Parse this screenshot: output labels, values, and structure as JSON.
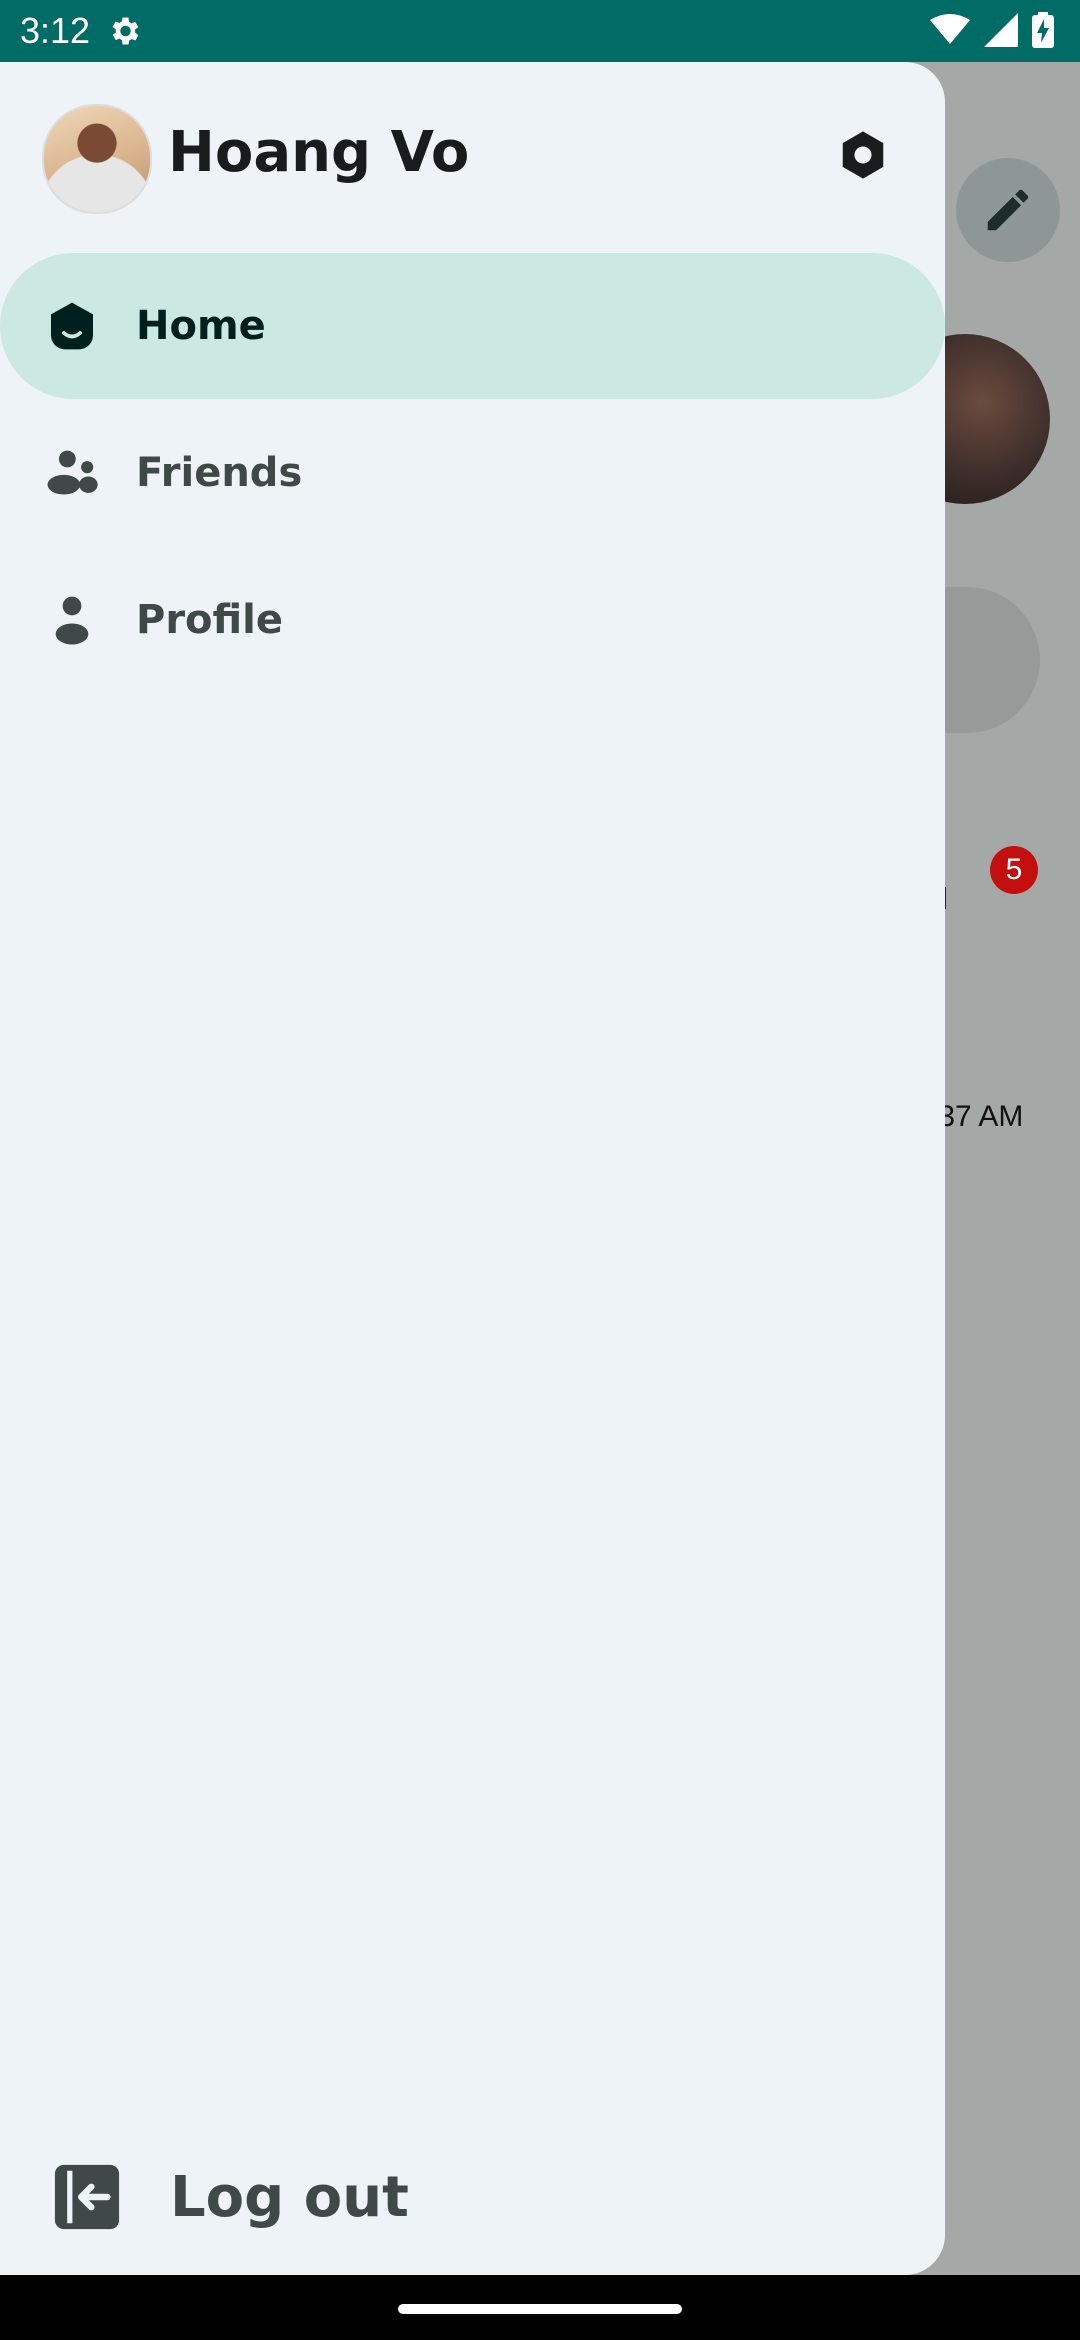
{
  "status_bar": {
    "time": "3:12",
    "icons": [
      "settings-gear-icon",
      "wifi-icon",
      "signal-icon",
      "battery-charging-icon"
    ]
  },
  "background_app": {
    "badge_count": "5",
    "time_snippet": ":37 AM"
  },
  "drawer": {
    "user": {
      "name": "Hoang Vo"
    },
    "items": [
      {
        "label": "Home",
        "icon": "home-icon",
        "active": true
      },
      {
        "label": "Friends",
        "icon": "people-icon",
        "active": false
      },
      {
        "label": "Profile",
        "icon": "person-icon",
        "active": false
      }
    ],
    "logout_label": "Log out"
  },
  "colors": {
    "status_bar": "#006c65",
    "drawer_bg": "#eef3f7",
    "active_pill": "#cce8e2",
    "text_dark": "#191c1c",
    "text_muted": "#3f4948",
    "scrim": "#a4a8a7",
    "badge": "#c40f0f"
  }
}
